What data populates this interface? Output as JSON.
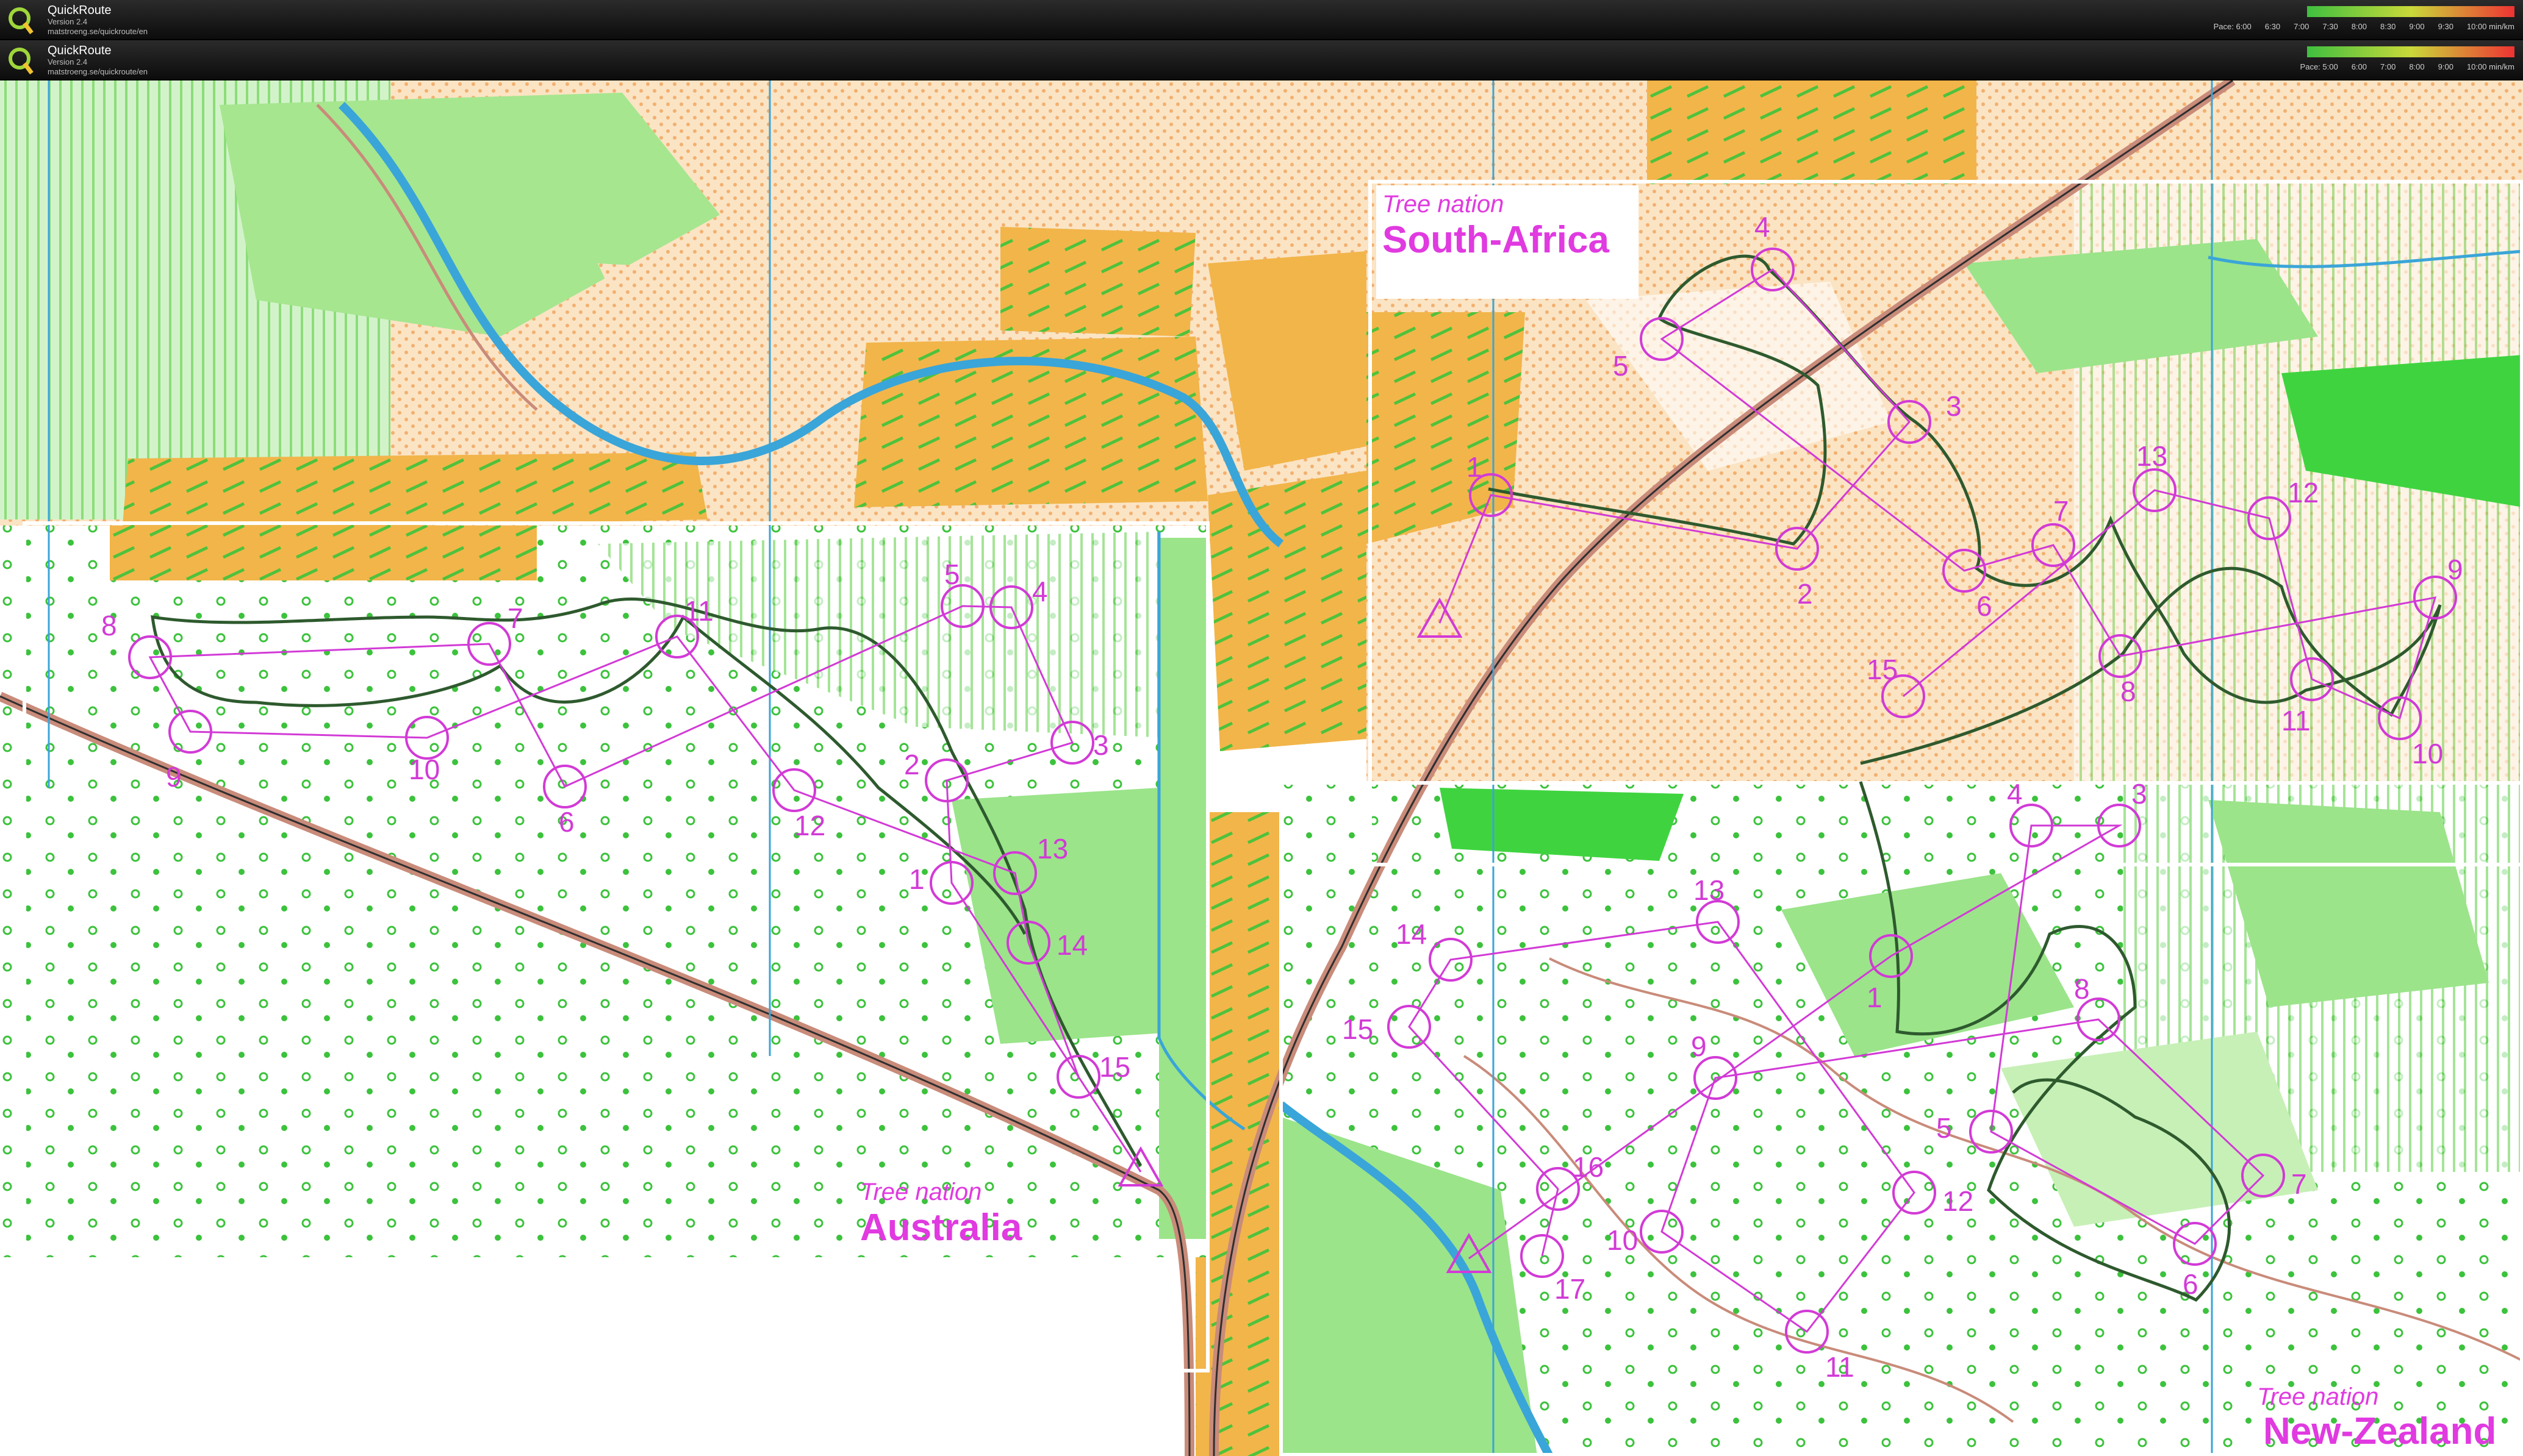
{
  "window_bars": [
    {
      "app_name": "QuickRoute",
      "version": "Version 2.4",
      "site": "matstroeng.se/quickroute/en",
      "pace_labels": [
        "Pace: 6:00",
        "6:30",
        "7:00",
        "7:30",
        "8:00",
        "8:30",
        "9:00",
        "9:30",
        "10:00 min/km"
      ]
    },
    {
      "app_name": "QuickRoute",
      "version": "Version 2.4",
      "site": "matstroeng.se/quickroute/en",
      "pace_labels": [
        "Pace: 5:00",
        "6:00",
        "7:00",
        "8:00",
        "9:00",
        "10:00 min/km"
      ]
    }
  ],
  "colors": {
    "course": "#d23ad6",
    "route": "#2e5a2e",
    "forest_green": "#8fe07a",
    "yellow": "#f2b54a",
    "road": "#c98b7a",
    "water": "#3aa5d8"
  },
  "map": {
    "maps": [
      {
        "name": "australia",
        "label_sub": "Tree nation",
        "label_main": "Australia",
        "controls": [
          "1",
          "2",
          "3",
          "4",
          "5",
          "6",
          "7",
          "8",
          "9",
          "10",
          "11",
          "12",
          "13",
          "14",
          "15"
        ]
      },
      {
        "name": "south-africa",
        "label_sub": "Tree nation",
        "label_main": "South-Africa",
        "controls": [
          "1",
          "2",
          "3",
          "4",
          "5",
          "6",
          "7",
          "8",
          "9",
          "10",
          "11",
          "12",
          "13",
          "15"
        ]
      },
      {
        "name": "new-zealand",
        "label_sub": "Tree nation",
        "label_main": "New-Zealand",
        "controls": [
          "1",
          "3",
          "4",
          "5",
          "6",
          "7",
          "8",
          "9",
          "10",
          "11",
          "12",
          "13",
          "14",
          "15",
          "16",
          "17"
        ]
      }
    ]
  }
}
